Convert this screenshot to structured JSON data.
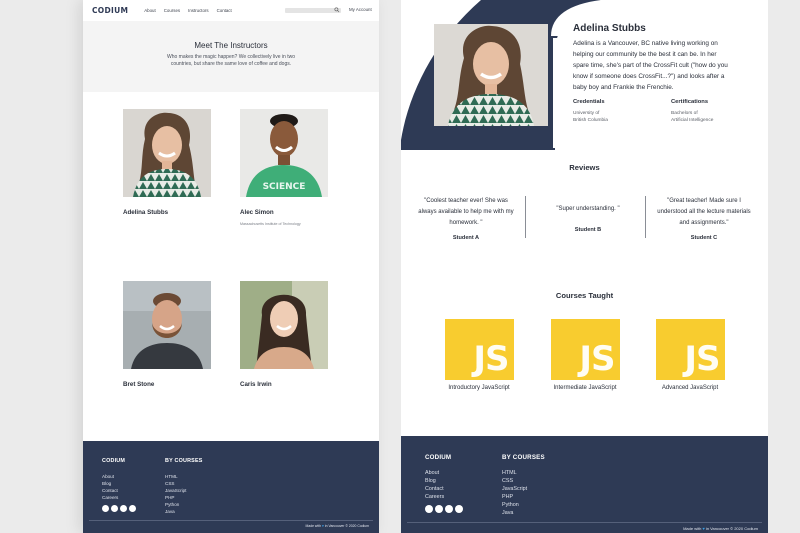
{
  "brand": "CODIUM",
  "nav": {
    "links": [
      "About",
      "Courses",
      "Instructors",
      "Contact"
    ],
    "account": "My Account"
  },
  "hero": {
    "title": "Meet The Instructors",
    "subtitle": "Who makes the magic happen? We collectively live in two countries, but share the same love of coffee and dogs."
  },
  "instructors": [
    {
      "name": "Adelina Stubbs",
      "meta": ""
    },
    {
      "name": "Alec Simon",
      "meta": "Massachusetts Institute of Technology"
    },
    {
      "name": "Bret Stone",
      "meta": ""
    },
    {
      "name": "Caris Irwin",
      "meta": ""
    }
  ],
  "profile": {
    "name": "Adelina Stubbs",
    "bio": "Adelina is a Vancouver, BC native living working on helping our community be the best it can be. In her spare time, she's part of the CrossFit cult (\"how do you know if someone does CrossFit...?\") and looks after a baby boy and Frankie the Frenchie.",
    "credentials_label": "Credentials",
    "credentials_lines": [
      "University of",
      "British Columbia"
    ],
    "certifications_label": "Certifications",
    "certifications_lines": [
      "Bachelors of",
      "Artificial Intelligence"
    ]
  },
  "reviews_title": "Reviews",
  "reviews": [
    {
      "quote": "\"Coolest teacher ever! She was always available to help me with my homework. \"",
      "author": "Student A"
    },
    {
      "quote": "\"Super understanding. \"",
      "author": "Student B"
    },
    {
      "quote": "\"Great teacher! Made sure I understood all the lecture materials and assignments.\"",
      "author": "Student  C"
    }
  ],
  "courses_title": "Courses Taught",
  "courses": [
    {
      "logo": "JS",
      "label": "Introductory JavaScript"
    },
    {
      "logo": "JS",
      "label": "Intermediate JavaScript"
    },
    {
      "logo": "JS",
      "label": "Advanced JavaScript"
    }
  ],
  "footer": {
    "brand": "CODIUM",
    "links_main": [
      "About",
      "Blog",
      "Contact",
      "Careers"
    ],
    "courses_label": "BY COURSES",
    "links_courses": [
      "HTML",
      "CSS",
      "JavaScript",
      "PHP",
      "Python",
      "Java"
    ],
    "social_icons": [
      "social-icon-1",
      "social-icon-2",
      "social-icon-3",
      "social-icon-4"
    ],
    "made_with": "Made with",
    "made_in": "in Vancouver",
    "copyright": "©  2020 Codium",
    "made_in_right": "in Vancouver"
  },
  "colors": {
    "navy": "#2e3a55",
    "js_yellow": "#f8cc2f",
    "hero_bg": "#f4f4f4",
    "heart": "#3aa0e8"
  }
}
